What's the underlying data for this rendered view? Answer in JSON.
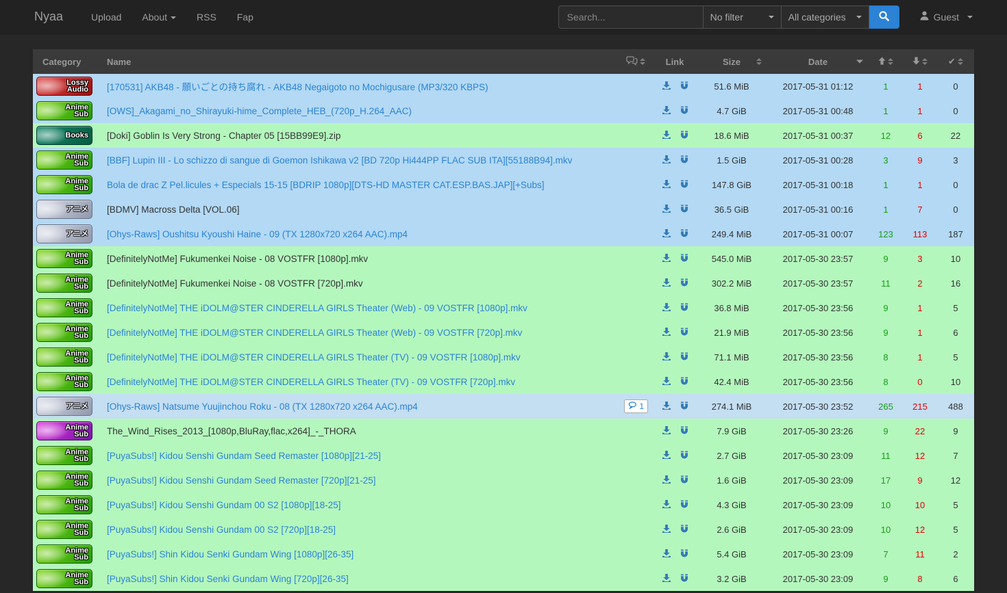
{
  "navbar": {
    "brand": "Nyaa",
    "links": [
      {
        "label": "Upload",
        "caret": false
      },
      {
        "label": "About",
        "caret": true
      },
      {
        "label": "RSS",
        "caret": false
      },
      {
        "label": "Fap",
        "caret": false
      }
    ],
    "search": {
      "placeholder": "Search...",
      "filter_value": "No filter",
      "category_value": "All categories"
    },
    "user": {
      "label": "Guest"
    }
  },
  "colors": {
    "navbar_bg": "#222222",
    "page_bg": "#272727",
    "header_bg": "#3a3a3a",
    "row_default": "#b3d9f5",
    "row_trusted": "#b4f7bd",
    "row_highlight": "#c4def2",
    "link_blue": "#2b83d6",
    "seeders_green": "#16a016",
    "leechers_red": "#e60000",
    "button_blue": "#2c82d4"
  },
  "categories": {
    "lossy-audio": {
      "label_lines": [
        "Lossy",
        "Audio"
      ],
      "bg_from": "#e04848",
      "bg_to": "#9c0d0d",
      "border": "#6e0808"
    },
    "anime-sub": {
      "label_lines": [
        "Anime",
        "Sub"
      ],
      "bg_from": "#86d81e",
      "bg_to": "#1f9a06",
      "border": "#116006"
    },
    "anime-sub-purple": {
      "label_lines": [
        "Anime",
        "Sub"
      ],
      "bg_from": "#e03ce0",
      "bg_to": "#7c12aa",
      "border": "#4d0a6e"
    },
    "books": {
      "label_lines": [
        "Books"
      ],
      "bg_from": "#12876a",
      "bg_to": "#065c41",
      "border": "#033d2b"
    },
    "anime-raw": {
      "label_lines": [
        "アニメ"
      ],
      "bg_from": "#d8dce8",
      "bg_to": "#9098ac",
      "border": "#6a7184"
    }
  },
  "table": {
    "headers": {
      "category": "Category",
      "name": "Name",
      "comments_icon": "comments-icon",
      "link": "Link",
      "size": "Size",
      "date": "Date",
      "seeders_icon": "arrow-up-icon",
      "leechers_icon": "arrow-down-icon",
      "completed_icon": "check-icon",
      "completed_glyph": "✔"
    },
    "rows": [
      {
        "category": "lossy-audio",
        "name": "[170531] AKB48 - 願いごとの持ち腐れ - AKB48 Negaigoto no Mochigusare (MP3/320 KBPS)",
        "visited": false,
        "size": "51.6 MiB",
        "date": "2017-05-31 01:12",
        "seeders": "1",
        "leechers": "1",
        "completed": "0",
        "style": "blue"
      },
      {
        "category": "anime-sub",
        "name": "[OWS]_Akagami_no_Shirayuki-hime_Complete_HEB_(720p_H.264_AAC)",
        "visited": false,
        "size": "4.7 GiB",
        "date": "2017-05-31 00:48",
        "seeders": "1",
        "leechers": "1",
        "completed": "0",
        "style": "blue"
      },
      {
        "category": "books",
        "name": "[Doki] Goblin Is Very Strong - Chapter 05 [15BB99E9].zip",
        "visited": true,
        "size": "18.6 MiB",
        "date": "2017-05-31 00:37",
        "seeders": "12",
        "leechers": "6",
        "completed": "22",
        "style": "green"
      },
      {
        "category": "anime-sub",
        "name": "[BBF] Lupin III - Lo schizzo di sangue di Goemon Ishikawa v2 [BD 720p Hi444PP FLAC SUB ITA][55188B94].mkv",
        "visited": false,
        "size": "1.5 GiB",
        "date": "2017-05-31 00:28",
        "seeders": "3",
        "leechers": "9",
        "completed": "3",
        "style": "blue"
      },
      {
        "category": "anime-sub",
        "name": "Bola de drac Z Pel.licules + Especials 15-15 [BDRIP 1080p][DTS-HD MASTER CAT.ESP.BAS.JAP][+Subs]",
        "visited": false,
        "size": "147.8 GiB",
        "date": "2017-05-31 00:18",
        "seeders": "1",
        "leechers": "1",
        "completed": "0",
        "style": "blue"
      },
      {
        "category": "anime-raw",
        "name": "[BDMV] Macross Delta [VOL.06]",
        "visited": true,
        "size": "36.5 GiB",
        "date": "2017-05-31 00:16",
        "seeders": "1",
        "leechers": "7",
        "completed": "0",
        "style": "blue"
      },
      {
        "category": "anime-raw",
        "name": "[Ohys-Raws] Oushitsu Kyoushi Haine - 09 (TX 1280x720 x264 AAC).mp4",
        "visited": false,
        "size": "249.4 MiB",
        "date": "2017-05-31 00:07",
        "seeders": "123",
        "leechers": "113",
        "completed": "187",
        "style": "blue"
      },
      {
        "category": "anime-sub",
        "name": "[DefinitelyNotMe] Fukumenkei Noise - 08 VOSTFR [1080p].mkv",
        "visited": true,
        "size": "545.0 MiB",
        "date": "2017-05-30 23:57",
        "seeders": "9",
        "leechers": "3",
        "completed": "10",
        "style": "green"
      },
      {
        "category": "anime-sub",
        "name": "[DefinitelyNotMe] Fukumenkei Noise - 08 VOSTFR [720p].mkv",
        "visited": true,
        "size": "302.2 MiB",
        "date": "2017-05-30 23:57",
        "seeders": "11",
        "leechers": "2",
        "completed": "16",
        "style": "green"
      },
      {
        "category": "anime-sub",
        "name": "[DefinitelyNotMe] THE iDOLM@STER CINDERELLA GIRLS Theater (Web) - 09 VOSTFR [1080p].mkv",
        "visited": false,
        "size": "36.8 MiB",
        "date": "2017-05-30 23:56",
        "seeders": "9",
        "leechers": "1",
        "completed": "5",
        "style": "green"
      },
      {
        "category": "anime-sub",
        "name": "[DefinitelyNotMe] THE iDOLM@STER CINDERELLA GIRLS Theater (Web) - 09 VOSTFR [720p].mkv",
        "visited": false,
        "size": "21.9 MiB",
        "date": "2017-05-30 23:56",
        "seeders": "9",
        "leechers": "1",
        "completed": "6",
        "style": "green"
      },
      {
        "category": "anime-sub",
        "name": "[DefinitelyNotMe] THE iDOLM@STER CINDERELLA GIRLS Theater (TV) - 09 VOSTFR [1080p].mkv",
        "visited": false,
        "size": "71.1 MiB",
        "date": "2017-05-30 23:56",
        "seeders": "8",
        "leechers": "1",
        "completed": "5",
        "style": "green"
      },
      {
        "category": "anime-sub",
        "name": "[DefinitelyNotMe] THE iDOLM@STER CINDERELLA GIRLS Theater (TV) - 09 VOSTFR [720p].mkv",
        "visited": false,
        "size": "42.4 MiB",
        "date": "2017-05-30 23:56",
        "seeders": "8",
        "leechers": "0",
        "completed": "10",
        "style": "green"
      },
      {
        "category": "anime-raw",
        "name": "[Ohys-Raws] Natsume Yuujinchou Roku - 08 (TX 1280x720 x264 AAC).mp4",
        "visited": false,
        "comments": "1",
        "size": "274.1 MiB",
        "date": "2017-05-30 23:52",
        "seeders": "265",
        "leechers": "215",
        "completed": "488",
        "style": "blue-hl"
      },
      {
        "category": "anime-sub-purple",
        "name": "The_Wind_Rises_2013_[1080p,BluRay,flac,x264]_-_THORA",
        "visited": true,
        "size": "7.9 GiB",
        "date": "2017-05-30 23:26",
        "seeders": "9",
        "leechers": "22",
        "completed": "9",
        "style": "green"
      },
      {
        "category": "anime-sub",
        "name": "[PuyaSubs!] Kidou Senshi Gundam Seed Remaster [1080p][21-25]",
        "visited": false,
        "size": "2.7 GiB",
        "date": "2017-05-30 23:09",
        "seeders": "11",
        "leechers": "12",
        "completed": "7",
        "style": "green"
      },
      {
        "category": "anime-sub",
        "name": "[PuyaSubs!] Kidou Senshi Gundam Seed Remaster [720p][21-25]",
        "visited": false,
        "size": "1.6 GiB",
        "date": "2017-05-30 23:09",
        "seeders": "17",
        "leechers": "9",
        "completed": "12",
        "style": "green"
      },
      {
        "category": "anime-sub",
        "name": "[PuyaSubs!] Kidou Senshi Gundam 00 S2 [1080p][18-25]",
        "visited": false,
        "size": "4.3 GiB",
        "date": "2017-05-30 23:09",
        "seeders": "10",
        "leechers": "10",
        "completed": "5",
        "style": "green"
      },
      {
        "category": "anime-sub",
        "name": "[PuyaSubs!] Kidou Senshi Gundam 00 S2 [720p][18-25]",
        "visited": false,
        "size": "2.6 GiB",
        "date": "2017-05-30 23:09",
        "seeders": "10",
        "leechers": "12",
        "completed": "5",
        "style": "green"
      },
      {
        "category": "anime-sub",
        "name": "[PuyaSubs!] Shin Kidou Senki Gundam Wing [1080p][26-35]",
        "visited": false,
        "size": "5.4 GiB",
        "date": "2017-05-30 23:09",
        "seeders": "7",
        "leechers": "11",
        "completed": "2",
        "style": "green"
      },
      {
        "category": "anime-sub",
        "name": "[PuyaSubs!] Shin Kidou Senki Gundam Wing [720p][26-35]",
        "visited": false,
        "size": "3.2 GiB",
        "date": "2017-05-30 23:09",
        "seeders": "9",
        "leechers": "8",
        "completed": "6",
        "style": "green"
      }
    ]
  }
}
